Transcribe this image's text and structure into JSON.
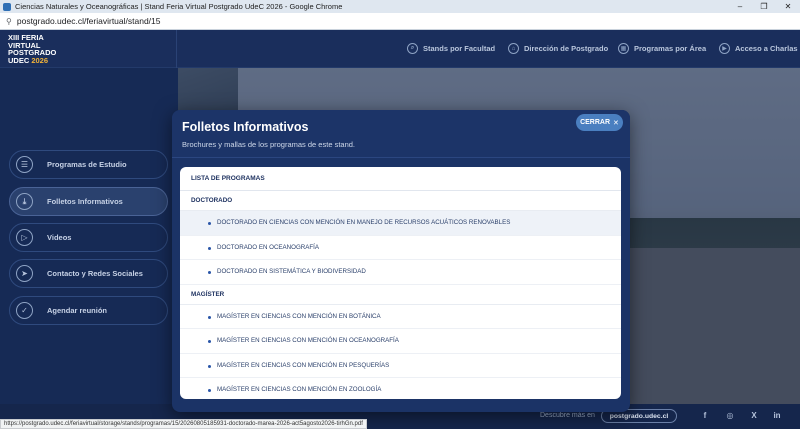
{
  "browser": {
    "window_title": "Ciencias Naturales y Oceanográficas | Stand Feria Virtual Postgrado UdeC 2026 - Google Chrome",
    "url": "postgrado.udec.cl/feriavirtual/stand/15",
    "status_url": "https://postgrado.udec.cl/feriavirtual/storage/stands/programas/15/20260805185931-doctorado-marea-2026-act5agosto2026-tirhGn.pdf",
    "controls": {
      "minimize": "–",
      "maximize": "❐",
      "close": "✕"
    }
  },
  "logo": {
    "line1": "XIII FERIA",
    "line2": "VIRTUAL",
    "line3": "POSTGRADO",
    "line4_prefix": "UDEC ",
    "year": "2026"
  },
  "nav": {
    "items": [
      {
        "label": "Stands por Facultad",
        "icon": "search-icon"
      },
      {
        "label": "Dirección de Postgrado",
        "icon": "home-icon"
      },
      {
        "label": "Programas por Área",
        "icon": "grid-icon"
      },
      {
        "label": "Acceso a Charlas",
        "icon": "video-icon"
      }
    ]
  },
  "sidebar": {
    "items": [
      {
        "label": "Programas de Estudio",
        "icon": "chat-icon"
      },
      {
        "label": "Folletos Informativos",
        "icon": "download-icon"
      },
      {
        "label": "Videos",
        "icon": "play-icon"
      },
      {
        "label": "Contacto y Redes Sociales",
        "icon": "send-icon"
      },
      {
        "label": "Agendar reunión",
        "icon": "check-icon"
      }
    ]
  },
  "modal": {
    "title": "Folletos Informativos",
    "subtitle": "Brochures y mallas de los programas de este stand.",
    "close_label": "CERRAR",
    "list_header": "LISTA DE PROGRAMAS",
    "groups": [
      {
        "name": "DOCTORADO",
        "programs": [
          "DOCTORADO EN CIENCIAS CON MENCIÓN EN MANEJO DE RECURSOS ACUÁTICOS RENOVABLES",
          "DOCTORADO EN OCEANOGRAFÍA",
          "DOCTORADO EN SISTEMÁTICA Y BIODIVERSIDAD"
        ]
      },
      {
        "name": "MAGÍSTER",
        "programs": [
          "MAGÍSTER EN CIENCIAS CON MENCIÓN EN BOTÁNICA",
          "MAGÍSTER EN CIENCIAS CON MENCIÓN EN OCEANOGRAFÍA",
          "MAGÍSTER EN CIENCIAS CON MENCIÓN EN PESQUERÍAS",
          "MAGÍSTER EN CIENCIAS CON MENCIÓN EN ZOOLOGÍA"
        ]
      }
    ]
  },
  "footer": {
    "discover_label": "Descubre más en",
    "site_label": "postgrado.udec.cl",
    "social": [
      "f",
      "◎",
      "X",
      "in"
    ]
  },
  "colors": {
    "navy": "#14284f",
    "accent": "#4a7fc0",
    "year": "#f0b23a"
  }
}
